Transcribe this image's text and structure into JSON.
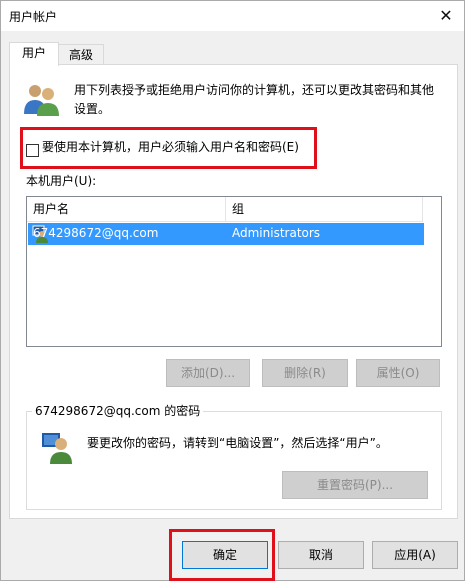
{
  "window": {
    "title": "用户帐户",
    "close_glyph": "✕"
  },
  "tabs": [
    {
      "label": "用户",
      "active": true
    },
    {
      "label": "高级",
      "active": false
    }
  ],
  "intro_text": "用下列表授予或拒绝用户访问你的计算机，还可以更改其密码和其他设置。",
  "require_login": {
    "label": "要使用本计算机，用户必须输入用户名和密码(E)",
    "checked": false
  },
  "local_users_label": "本机用户(U):",
  "users_table": {
    "columns": [
      "用户名",
      "组"
    ],
    "rows": [
      {
        "user": "674298672@qq.com",
        "group": "Administrators",
        "selected": true
      }
    ]
  },
  "user_buttons": {
    "add": "添加(D)...",
    "remove": "删除(R)",
    "properties": "属性(O)"
  },
  "password_group": {
    "title": "674298672@qq.com 的密码",
    "text": "要更改你的密码，请转到“电脑设置”，然后选择“用户”。",
    "reset_button": "重置密码(P)..."
  },
  "footer_buttons": {
    "ok": "确定",
    "cancel": "取消",
    "apply": "应用(A)"
  },
  "colors": {
    "highlight_red": "#e0101a",
    "selection_blue": "#3399ff"
  }
}
